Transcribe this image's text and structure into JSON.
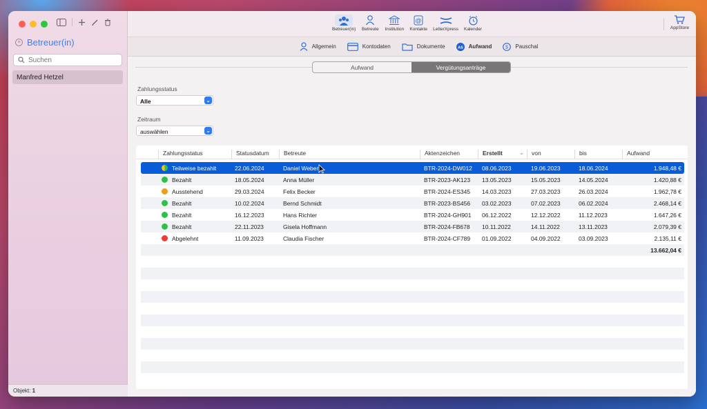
{
  "sidebar": {
    "title": "Betreuer(in)",
    "search_placeholder": "Suchen",
    "selected_item": "Manfred Hetzel",
    "footer_label": "Objekt:",
    "footer_count": "1"
  },
  "toolbar": {
    "items": [
      {
        "label": "Betreuer(in)",
        "icon": "person-group-icon"
      },
      {
        "label": "Betreute",
        "icon": "person-icon"
      },
      {
        "label": "Institution",
        "icon": "building-columns-icon"
      },
      {
        "label": "Kontakte",
        "icon": "at-contact-icon"
      },
      {
        "label": "LetterXpress",
        "icon": "letterxpress-icon"
      },
      {
        "label": "Kalender",
        "icon": "alarm-clock-icon"
      }
    ],
    "appstore_label": "AppStore"
  },
  "subtabs": [
    {
      "label": "Allgemein"
    },
    {
      "label": "Kontodaten"
    },
    {
      "label": "Dokumente"
    },
    {
      "label": "Aufwand"
    },
    {
      "label": "Pauschal"
    }
  ],
  "segments": {
    "left": "Aufwand",
    "right": "Vergütungsanträge"
  },
  "filters": {
    "status_label": "Zahlungsstatus",
    "status_value": "Alle",
    "period_label": "Zeitraum",
    "period_value": "auswählen"
  },
  "table": {
    "headers": {
      "status": "Zahlungsstatus",
      "statusdate": "Statusdatum",
      "betreute": "Betreute",
      "aktenzeichen": "Aktenzeichen",
      "erstellt": "Erstellt",
      "von": "von",
      "bis": "bis",
      "aufwand": "Aufwand"
    },
    "rows": [
      {
        "status": "Teilweise bezahlt",
        "statusdate": "22.06.2024",
        "betreute": "Daniel Weber",
        "aktenzeichen": "BTR-2024-DW012",
        "erstellt": "08.06.2023",
        "von": "19.06.2023",
        "bis": "18.06.2024",
        "aufwand": "1.948,48 €"
      },
      {
        "status": "Bezahlt",
        "statusdate": "18.05.2024",
        "betreute": "Anna Müller",
        "aktenzeichen": "BTR-2023-AK123",
        "erstellt": "13.05.2023",
        "von": "15.05.2023",
        "bis": "14.05.2024",
        "aufwand": "1.420,88 €"
      },
      {
        "status": "Ausstehend",
        "statusdate": "29.03.2024",
        "betreute": "Felix Becker",
        "aktenzeichen": "BTR-2024-ES345",
        "erstellt": "14.03.2023",
        "von": "27.03.2023",
        "bis": "26.03.2024",
        "aufwand": "1.962,78 €"
      },
      {
        "status": "Bezahlt",
        "statusdate": "10.02.2024",
        "betreute": "Bernd Schmidt",
        "aktenzeichen": "BTR-2023-BS456",
        "erstellt": "03.02.2023",
        "von": "07.02.2023",
        "bis": "06.02.2024",
        "aufwand": "2.468,14 €"
      },
      {
        "status": "Bezahlt",
        "statusdate": "16.12.2023",
        "betreute": "Hans Richter",
        "aktenzeichen": "BTR-2024-GH901",
        "erstellt": "06.12.2022",
        "von": "12.12.2022",
        "bis": "11.12.2023",
        "aufwand": "1.647,26 €"
      },
      {
        "status": "Bezahlt",
        "statusdate": "22.11.2023",
        "betreute": "Gisela Hoffmann",
        "aktenzeichen": "BTR-2024-FB678",
        "erstellt": "10.11.2022",
        "von": "14.11.2022",
        "bis": "13.11.2023",
        "aufwand": "2.079,39 €"
      },
      {
        "status": "Abgelehnt",
        "statusdate": "11.09.2023",
        "betreute": "Claudia Fischer",
        "aktenzeichen": "BTR-2024-CF789",
        "erstellt": "01.09.2022",
        "von": "04.09.2022",
        "bis": "03.09.2023",
        "aufwand": "2.135,11 €"
      }
    ],
    "total": "13.662,04 €"
  },
  "colors": {
    "accent": "#0a5bd8",
    "paid": "#2cc24a",
    "pending": "#f39c19",
    "rejected": "#ef3b36",
    "partial": "#f3c319"
  }
}
